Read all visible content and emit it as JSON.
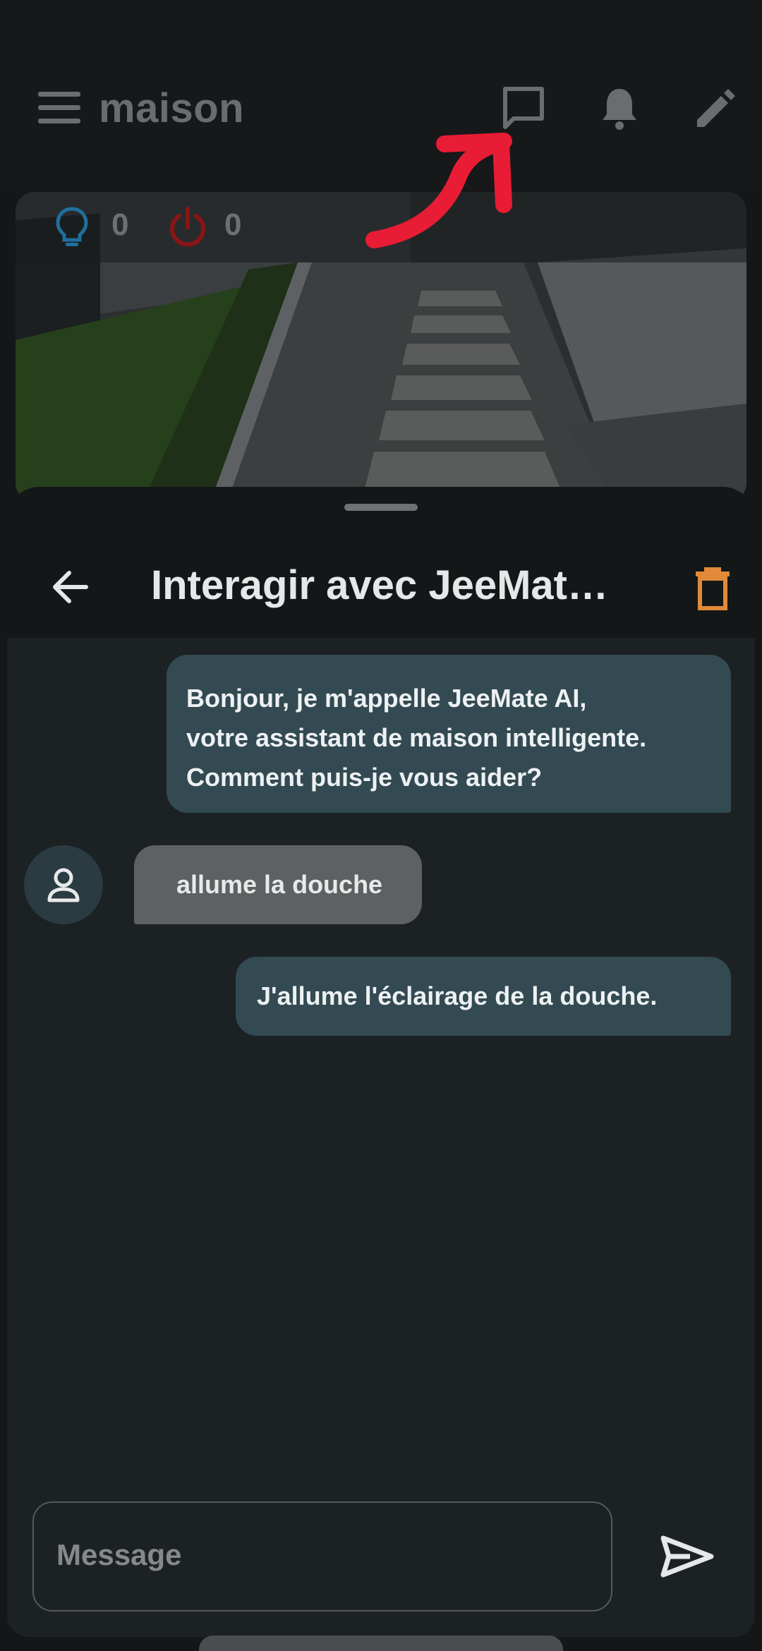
{
  "app_bar": {
    "title": "maison",
    "icons": [
      "menu-icon",
      "chat-icon",
      "bell-icon",
      "pencil-icon"
    ]
  },
  "stats": {
    "lights_on": "0",
    "power_on": "0",
    "light_color": "#1f6f9c",
    "power_color": "#8a1515"
  },
  "annotation": {
    "color": "#e81c34"
  },
  "chat_sheet": {
    "title": "Interagir avec JeeMate AI",
    "accent_delete": "#e08a3a",
    "messages": [
      {
        "role": "assistant",
        "text": "Bonjour, je m'appelle JeeMate AI,\nvotre assistant de maison intelligente.\nComment puis-je vous aider?"
      },
      {
        "role": "user",
        "text": "allume la douche"
      },
      {
        "role": "assistant",
        "text": "J'allume l'éclairage de la douche."
      }
    ],
    "input": {
      "placeholder": "Message",
      "value": ""
    }
  }
}
